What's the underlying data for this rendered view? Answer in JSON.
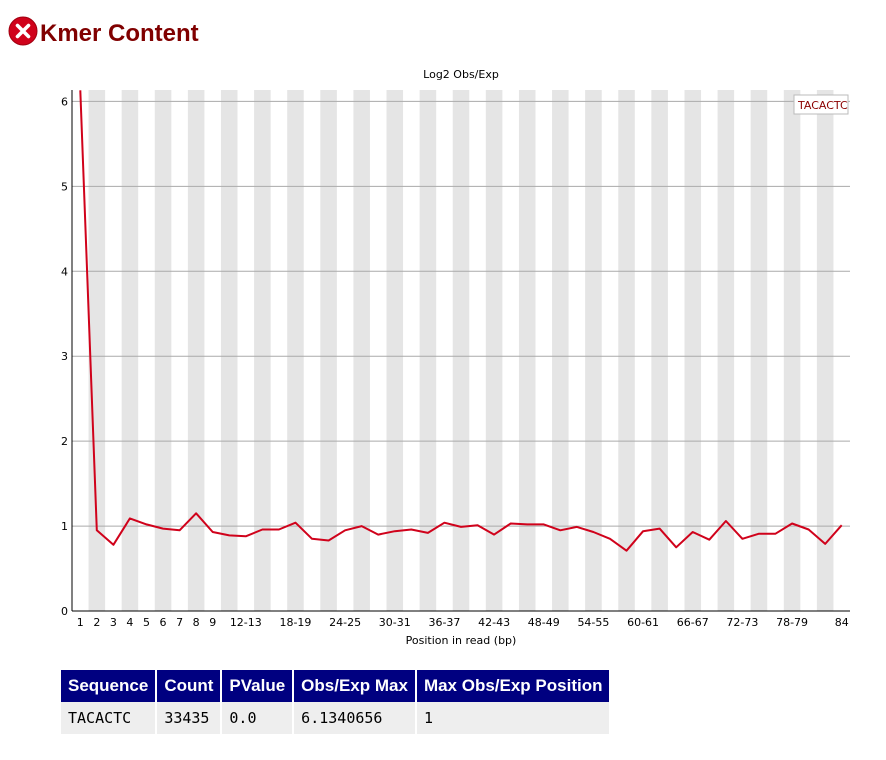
{
  "header": {
    "title": "Kmer Content",
    "status_icon": "fail-icon",
    "status_color": "#d0021b"
  },
  "chart_data": {
    "type": "line",
    "title": "Log2 Obs/Exp",
    "xlabel": "Position in read (bp)",
    "ylabel": "",
    "ylim": [
      0,
      6.1340656
    ],
    "yticks": [
      0,
      1,
      2,
      3,
      4,
      5,
      6
    ],
    "grid": true,
    "legend_position": "top-right",
    "categories": [
      "1",
      "2",
      "3",
      "4",
      "5",
      "6",
      "7",
      "8",
      "9",
      "10-11",
      "12-13",
      "14-15",
      "16-17",
      "18-19",
      "20-21",
      "22-23",
      "24-25",
      "26-27",
      "28-29",
      "30-31",
      "32-33",
      "34-35",
      "36-37",
      "38-39",
      "40-41",
      "42-43",
      "44-45",
      "46-47",
      "48-49",
      "50-51",
      "52-53",
      "54-55",
      "56-57",
      "58-59",
      "60-61",
      "62-63",
      "64-65",
      "66-67",
      "68-69",
      "70-71",
      "72-73",
      "74-75",
      "76-77",
      "78-79",
      "80-81",
      "82-83",
      "84"
    ],
    "tick_labels": [
      "1",
      "2",
      "3",
      "4",
      "5",
      "6",
      "7",
      "8",
      "9",
      "",
      "12-13",
      "",
      "",
      "18-19",
      "",
      "",
      "24-25",
      "",
      "",
      "30-31",
      "",
      "",
      "36-37",
      "",
      "",
      "42-43",
      "",
      "",
      "48-49",
      "",
      "",
      "54-55",
      "",
      "",
      "60-61",
      "",
      "",
      "66-67",
      "",
      "",
      "72-73",
      "",
      "",
      "78-79",
      "",
      "",
      "84"
    ],
    "series": [
      {
        "name": "TACACTC",
        "color": "#d0021b",
        "values": [
          6.13,
          0.95,
          0.78,
          1.09,
          1.02,
          0.97,
          0.95,
          1.15,
          0.93,
          0.89,
          0.88,
          0.96,
          0.96,
          1.04,
          0.85,
          0.83,
          0.95,
          1.0,
          0.9,
          0.94,
          0.96,
          0.92,
          1.04,
          0.99,
          1.01,
          0.9,
          1.03,
          1.02,
          1.02,
          0.95,
          0.99,
          0.93,
          0.85,
          0.71,
          0.94,
          0.97,
          0.75,
          0.93,
          0.84,
          1.06,
          0.85,
          0.91,
          0.91,
          1.03,
          0.96,
          0.79,
          1.01
        ]
      }
    ]
  },
  "table": {
    "columns": [
      "Sequence",
      "Count",
      "PValue",
      "Obs/Exp Max",
      "Max Obs/Exp Position"
    ],
    "rows": [
      [
        "TACACTC",
        "33435",
        "0.0",
        "6.1340656",
        "1"
      ]
    ]
  }
}
